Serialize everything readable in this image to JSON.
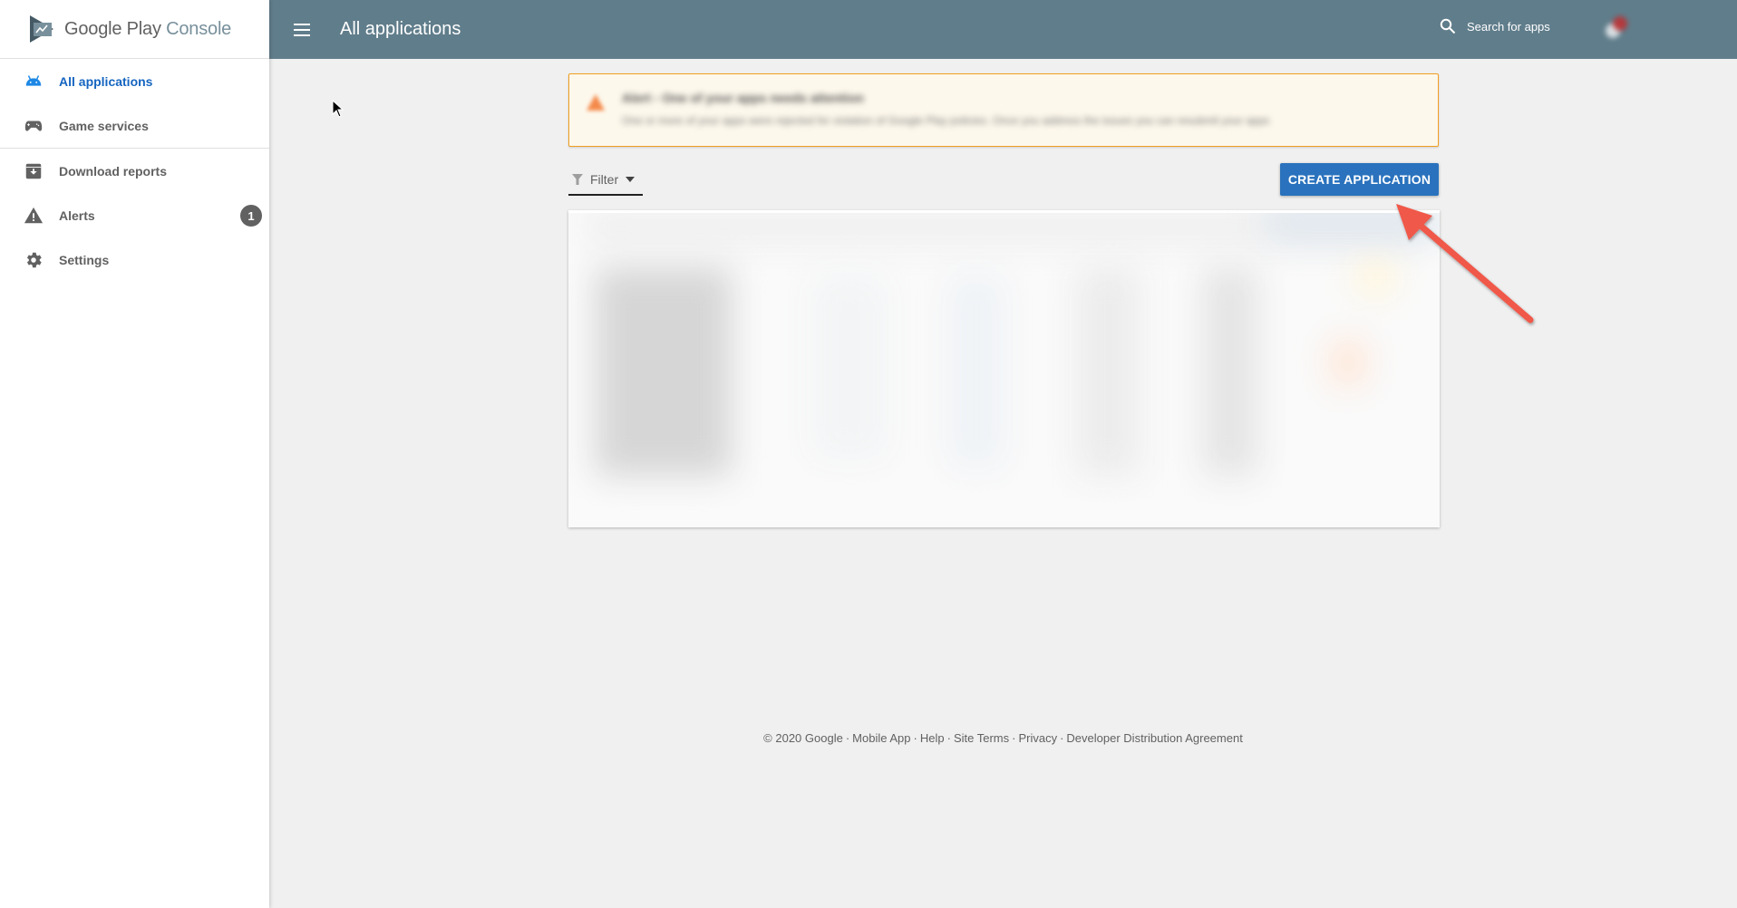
{
  "app": {
    "logo_word1": "Google Play",
    "logo_word2": "Console"
  },
  "sidebar": {
    "items": [
      {
        "label": "All applications",
        "icon": "android-icon",
        "active": true
      },
      {
        "label": "Game services",
        "icon": "gamepad-icon",
        "active": false
      },
      {
        "label": "Download reports",
        "icon": "download-box-icon",
        "active": false
      },
      {
        "label": "Alerts",
        "icon": "warning-icon",
        "active": false,
        "badge": "1"
      },
      {
        "label": "Settings",
        "icon": "gear-icon",
        "active": false
      }
    ]
  },
  "header": {
    "title": "All applications",
    "search_placeholder": "Search for apps",
    "help_glyph": "?"
  },
  "alert": {
    "title": "Alert - One of your apps needs attention",
    "description": "One or more of your apps were rejected for violation of Google Play policies. Once you address the issues you can resubmit your apps",
    "redacted": true
  },
  "toolbar": {
    "filter_label": "Filter",
    "create_label": "CREATE APPLICATION"
  },
  "app_list": {
    "redacted": true
  },
  "footer": {
    "copyright": "© 2020 Google",
    "links": [
      "Mobile App",
      "Help",
      "Site Terms",
      "Privacy",
      "Developer Distribution Agreement"
    ]
  },
  "colors": {
    "header_bg": "#607d8b",
    "accent": "#1565c0",
    "button_bg": "#2a72bd",
    "alert_border": "#f0a020",
    "annotation_arrow": "#f0584a"
  }
}
